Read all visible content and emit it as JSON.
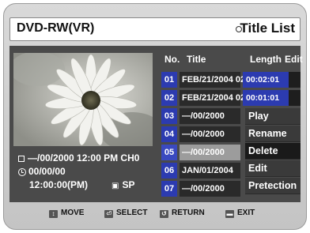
{
  "header": {
    "device": "DVD-RW(VR)",
    "title": "Title List"
  },
  "info": {
    "date_line": "—/00/2000 12:00 PM CH0",
    "duration": "00/00/00",
    "time_line": "12:00:00(PM)",
    "mode": "SP"
  },
  "columns": {
    "no": "No.",
    "title": "Title",
    "length": "Length",
    "edit": "Edit"
  },
  "rows": [
    {
      "no": "01",
      "title": "FEB/21/2004 02",
      "length": "00:02:01"
    },
    {
      "no": "02",
      "title": "FEB/21/2004 02",
      "length": "00:01:01"
    },
    {
      "no": "03",
      "title": "—/00/2000",
      "length": ""
    },
    {
      "no": "04",
      "title": "—/00/2000",
      "length": ""
    },
    {
      "no": "05",
      "title": "—/00/2000",
      "length": "",
      "selected": true
    },
    {
      "no": "06",
      "title": "JAN/01/2004",
      "length": ""
    },
    {
      "no": "07",
      "title": "—/00/2000",
      "length": ""
    }
  ],
  "context_menu": {
    "items": [
      "Play",
      "Rename",
      "Delete",
      "Edit",
      "Pretection"
    ],
    "selected": "Delete"
  },
  "footer": {
    "move": "MOVE",
    "select": "SELECT",
    "return": "RETURN",
    "exit": "EXIT"
  },
  "icons": {
    "mode": "lock-icon",
    "move": "updown-arrows-icon",
    "select": "enter-icon",
    "return": "return-icon",
    "exit": "exit-icon"
  },
  "colors": {
    "accent": "#2c3bb0",
    "panel": "#4a4a4a",
    "selected_row": "#9c9c9c"
  }
}
